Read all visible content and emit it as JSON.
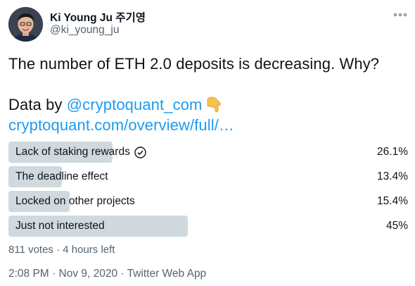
{
  "author": {
    "display_name": "Ki Young Ju 주기영",
    "handle": "@ki_young_ju"
  },
  "tweet": {
    "line1": "The number of ETH 2.0 deposits is decreasing. Why?",
    "line2_prefix": "Data by ",
    "mention": "@cryptoquant_com",
    "emoji_icon": "pointing-down-hand-emoji",
    "url": "cryptoquant.com/overview/full/…"
  },
  "poll": {
    "options": [
      {
        "label": "Lack of staking rewards",
        "percent": "26.1%",
        "fraction": 0.261,
        "winner_check": true
      },
      {
        "label": "The deadline effect",
        "percent": "13.4%",
        "fraction": 0.134,
        "winner_check": false
      },
      {
        "label": "Locked on other projects",
        "percent": "15.4%",
        "fraction": 0.154,
        "winner_check": false
      },
      {
        "label": "Just not interested",
        "percent": "45%",
        "fraction": 0.45,
        "winner_check": false
      }
    ],
    "meta": "811 votes · 4 hours left"
  },
  "footer": {
    "time": "2:08 PM",
    "date": "Nov 9, 2020",
    "source": "Twitter Web App",
    "separator": " · "
  },
  "colors": {
    "link": "#1d9bf0",
    "bar": "#cfd9de",
    "muted": "#536471",
    "text": "#0f1419"
  },
  "icons": {
    "more": "more-dots-icon",
    "check": "check-circle-icon"
  }
}
